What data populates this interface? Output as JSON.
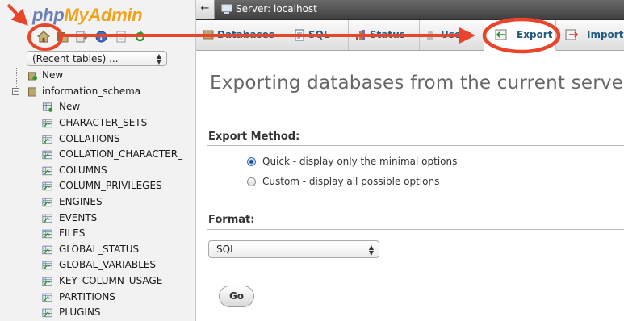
{
  "logo": {
    "part1": "php",
    "part2": "MyAdmin"
  },
  "sidebar": {
    "quick_icons": [
      "home-icon",
      "database-icon",
      "exit-icon",
      "help-icon",
      "docs-icon",
      "reload-icon"
    ],
    "recent_tables": "(Recent tables) ...",
    "tree": {
      "new_label": "New",
      "database": "information_schema",
      "db_new_label": "New",
      "tables": [
        "CHARACTER_SETS",
        "COLLATIONS",
        "COLLATION_CHARACTER_",
        "COLUMNS",
        "COLUMN_PRIVILEGES",
        "ENGINES",
        "EVENTS",
        "FILES",
        "GLOBAL_STATUS",
        "GLOBAL_VARIABLES",
        "KEY_COLUMN_USAGE",
        "PARTITIONS",
        "PLUGINS"
      ]
    }
  },
  "topbar": {
    "back_label": "←",
    "server_label": "Server: localhost"
  },
  "tabs": [
    {
      "label": "Databases",
      "icon": "database-icon"
    },
    {
      "label": "SQL",
      "icon": "sql-icon"
    },
    {
      "label": "Status",
      "icon": "status-icon"
    },
    {
      "label": "Users",
      "icon": "users-icon"
    },
    {
      "label": "Export",
      "icon": "export-icon",
      "active": true
    },
    {
      "label": "Import",
      "icon": "import-icon"
    }
  ],
  "main": {
    "title": "Exporting databases from the current server",
    "export_method": {
      "heading": "Export Method:",
      "options": [
        {
          "label": "Quick - display only the minimal options",
          "checked": true
        },
        {
          "label": "Custom - display all possible options",
          "checked": false
        }
      ]
    },
    "format": {
      "heading": "Format:",
      "selected": "SQL"
    },
    "go_label": "Go"
  },
  "colors": {
    "annotation": "#e8452b",
    "link": "#235a81",
    "topbar": "#4a4a4a"
  }
}
